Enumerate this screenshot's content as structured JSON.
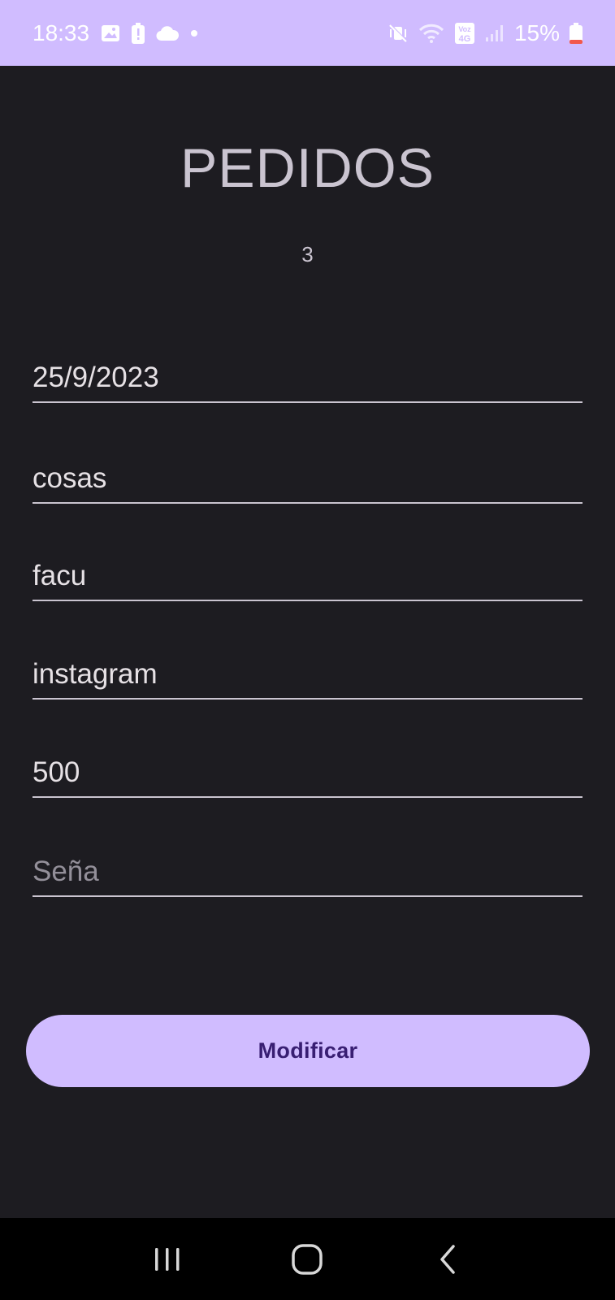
{
  "status_bar": {
    "time": "18:33",
    "battery_percent": "15%",
    "network_badge": "Voz 4G",
    "left_icons": [
      "image-icon",
      "battery-alert-icon",
      "cloud-icon",
      "dot-icon"
    ],
    "right_icons": [
      "mute-vibrate-icon",
      "wifi-icon",
      "volte-4g-icon",
      "signal-icon",
      "battery-low-icon"
    ]
  },
  "header": {
    "title": "PEDIDOS",
    "order_number": "3"
  },
  "form": {
    "fecha": {
      "value": "25/9/2023",
      "placeholder": ""
    },
    "descripcion": {
      "value": "cosas",
      "placeholder": ""
    },
    "cliente": {
      "value": "facu",
      "placeholder": ""
    },
    "medio": {
      "value": "instagram",
      "placeholder": ""
    },
    "precio": {
      "value": "500",
      "placeholder": ""
    },
    "sena": {
      "value": "",
      "placeholder": "Seña"
    },
    "submit_label": "Modificar"
  },
  "nav_bar": {
    "icons": [
      "recent-apps-icon",
      "home-icon",
      "back-icon"
    ]
  },
  "colors": {
    "accent": "#d0bcff",
    "background": "#1d1c21",
    "button_text": "#381e72",
    "battery_low": "#f2584b"
  }
}
